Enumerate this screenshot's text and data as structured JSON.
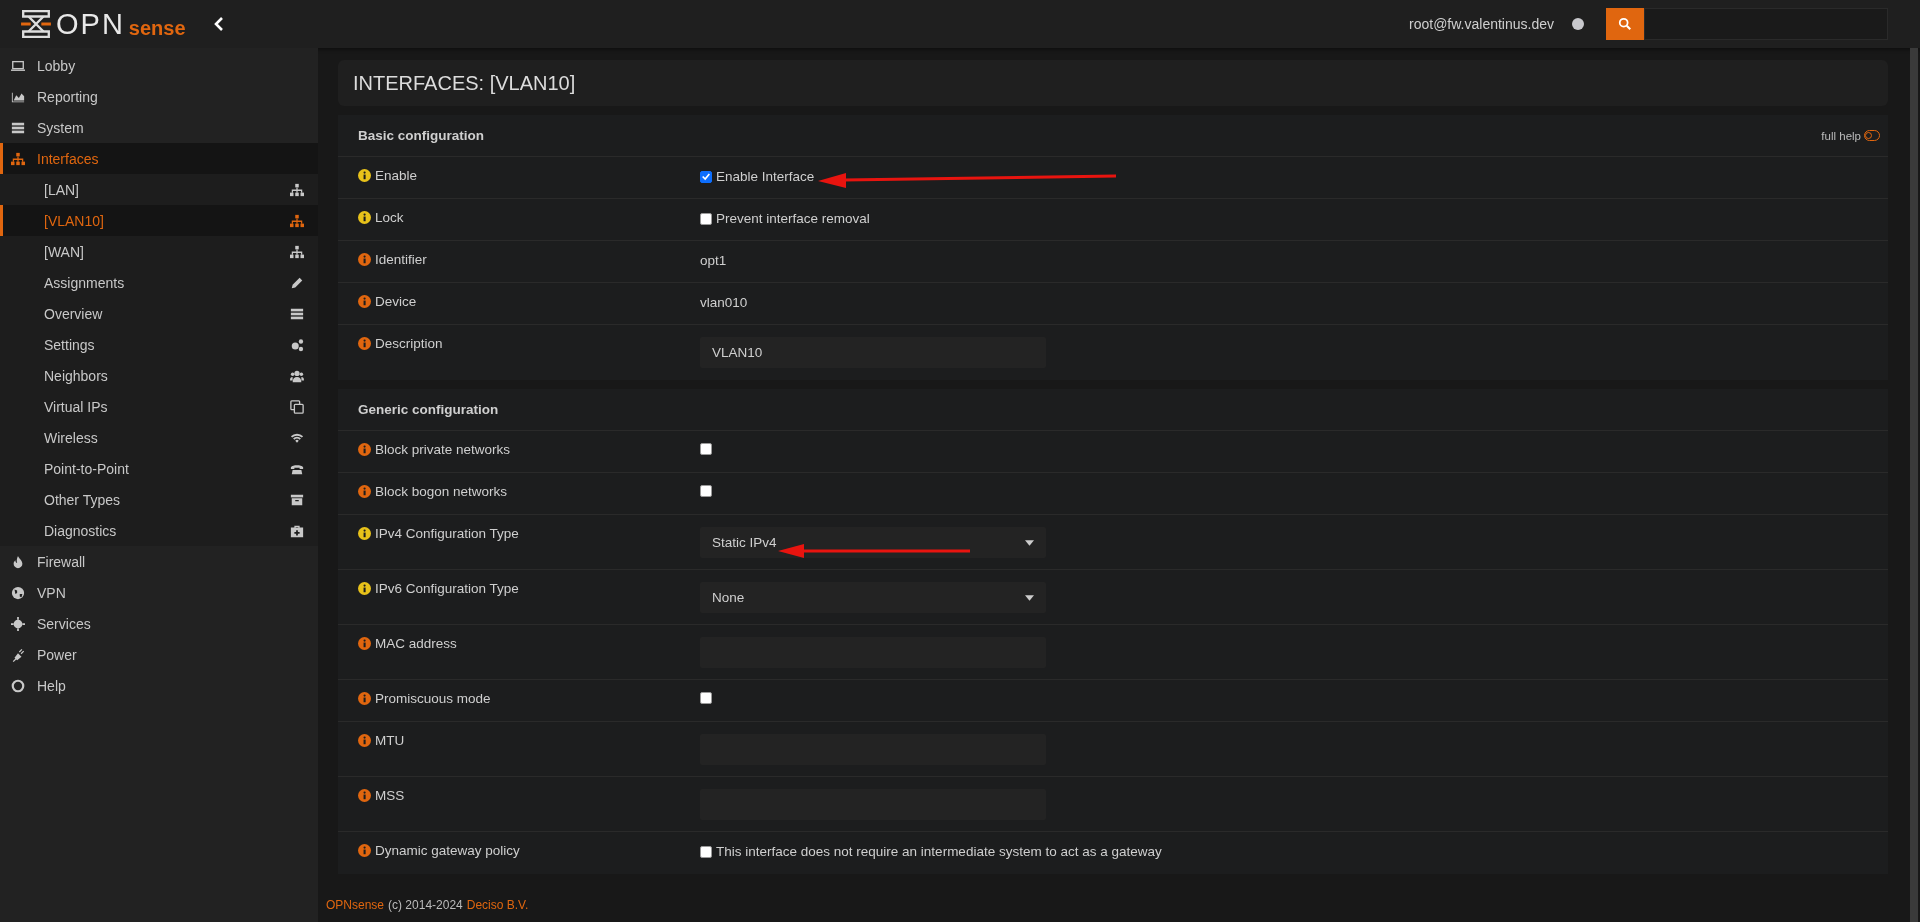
{
  "brand": {
    "left": "OPN",
    "right": "sense"
  },
  "topbar": {
    "user": "root@fw.valentinus.dev"
  },
  "sidebar": {
    "items": [
      {
        "label": "Lobby",
        "selected": false
      },
      {
        "label": "Reporting",
        "selected": false
      },
      {
        "label": "System",
        "selected": false
      },
      {
        "label": "Interfaces",
        "selected": true,
        "children": [
          {
            "label": "[LAN]",
            "selected": false
          },
          {
            "label": "[VLAN10]",
            "selected": true
          },
          {
            "label": "[WAN]",
            "selected": false
          },
          {
            "label": "Assignments",
            "selected": false
          },
          {
            "label": "Overview",
            "selected": false
          },
          {
            "label": "Settings",
            "selected": false
          },
          {
            "label": "Neighbors",
            "selected": false
          },
          {
            "label": "Virtual IPs",
            "selected": false
          },
          {
            "label": "Wireless",
            "selected": false
          },
          {
            "label": "Point-to-Point",
            "selected": false
          },
          {
            "label": "Other Types",
            "selected": false
          },
          {
            "label": "Diagnostics",
            "selected": false
          }
        ]
      },
      {
        "label": "Firewall",
        "selected": false
      },
      {
        "label": "VPN",
        "selected": false
      },
      {
        "label": "Services",
        "selected": false
      },
      {
        "label": "Power",
        "selected": false
      },
      {
        "label": "Help",
        "selected": false
      }
    ]
  },
  "page_title": "INTERFACES: [VLAN10]",
  "sections": [
    {
      "title": "Basic configuration",
      "full_help": {
        "label": "full help",
        "on": false
      },
      "rows": [
        {
          "label": "Enable",
          "color": "#e8c21a",
          "kind": "checkbox",
          "checked": true,
          "text": "Enable Interface"
        },
        {
          "label": "Lock",
          "color": "#e8c21a",
          "kind": "checkbox",
          "checked": false,
          "text": "Prevent interface removal"
        },
        {
          "label": "Identifier",
          "color": "#e0660f",
          "kind": "text",
          "value": "opt1"
        },
        {
          "label": "Device",
          "color": "#e0660f",
          "kind": "text",
          "value": "vlan010"
        },
        {
          "label": "Description",
          "color": "#e0660f",
          "kind": "input",
          "value": "VLAN10"
        }
      ]
    },
    {
      "title": "Generic configuration",
      "rows": [
        {
          "label": "Block private networks",
          "color": "#e0660f",
          "kind": "checkbox",
          "checked": false
        },
        {
          "label": "Block bogon networks",
          "color": "#e0660f",
          "kind": "checkbox",
          "checked": false
        },
        {
          "label": "IPv4 Configuration Type",
          "color": "#e8c21a",
          "kind": "select",
          "value": "Static IPv4"
        },
        {
          "label": "IPv6 Configuration Type",
          "color": "#e8c21a",
          "kind": "select",
          "value": "None"
        },
        {
          "label": "MAC address",
          "color": "#e0660f",
          "kind": "input"
        },
        {
          "label": "Promiscuous mode",
          "color": "#e0660f",
          "kind": "checkbox",
          "checked": false
        },
        {
          "label": "MTU",
          "color": "#e0660f",
          "kind": "input"
        },
        {
          "label": "MSS",
          "color": "#e0660f",
          "kind": "input"
        },
        {
          "label": "Dynamic gateway policy",
          "color": "#e0660f",
          "kind": "checkbox",
          "checked": false,
          "text": "This interface does not require an intermediate system to act as a gateway"
        }
      ]
    }
  ],
  "footer": {
    "brand": "OPNsense",
    "copyright": "(c) 2014-2024",
    "company": "Deciso B.V."
  }
}
